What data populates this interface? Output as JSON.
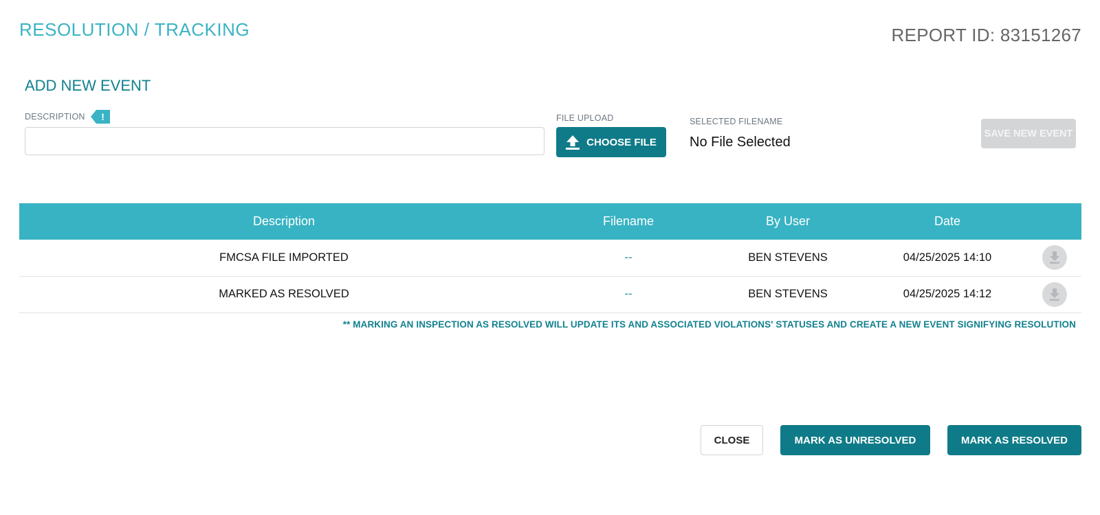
{
  "header": {
    "title": "RESOLUTION / TRACKING",
    "report_id": "REPORT ID: 83151267"
  },
  "add_event": {
    "title": "ADD NEW EVENT",
    "description_label": "DESCRIPTION",
    "required_mark": "!",
    "description_value": "",
    "file_upload_label": "FILE UPLOAD",
    "choose_file_label": "CHOOSE FILE",
    "selected_filename_label": "SELECTED FILENAME",
    "selected_filename_value": "No File Selected",
    "save_label": "SAVE NEW EVENT"
  },
  "table": {
    "columns": [
      "Description",
      "Filename",
      "By User",
      "Date"
    ],
    "rows": [
      {
        "description": "FMCSA FILE IMPORTED",
        "filename": "--",
        "user": "BEN STEVENS",
        "date": "04/25/2025 14:10"
      },
      {
        "description": "MARKED AS RESOLVED",
        "filename": "--",
        "user": "BEN STEVENS",
        "date": "04/25/2025 14:12"
      }
    ]
  },
  "note": "** MARKING AN INSPECTION AS RESOLVED WILL UPDATE ITS AND ASSOCIATED VIOLATIONS' STATUSES AND CREATE A NEW EVENT SIGNIFYING RESOLUTION",
  "footer": {
    "close_label": "CLOSE",
    "unresolve_label": "MARK AS UNRESOLVED",
    "resolve_label": "MARK AS RESOLVED"
  },
  "icons": {
    "upload": "upload-icon",
    "download": "download-icon",
    "required": "exclamation-icon"
  },
  "colors": {
    "accent": "#3ab3c4",
    "primary_button": "#0f7b88",
    "table_header": "#38b3c3",
    "disabled_button": "#d3d5d7"
  }
}
